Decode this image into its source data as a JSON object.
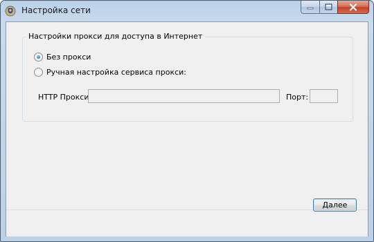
{
  "window": {
    "title": "Настройка сети",
    "app_icon": "network-shield-icon"
  },
  "caption_buttons": {
    "minimize_icon": "minimize-icon",
    "maximize_icon": "maximize-icon",
    "close_icon": "close-icon"
  },
  "proxy_group": {
    "label": "Настройки прокси для доступа в Интернет",
    "options": [
      {
        "label": "Без прокси",
        "checked": true
      },
      {
        "label": "Ручная настройка сервиса прокси:",
        "checked": false
      }
    ],
    "http_proxy_label": "HTTP Прокси:",
    "http_proxy_value": "",
    "port_label": "Порт:",
    "port_value": ""
  },
  "footer": {
    "next_label": "Далее"
  }
}
